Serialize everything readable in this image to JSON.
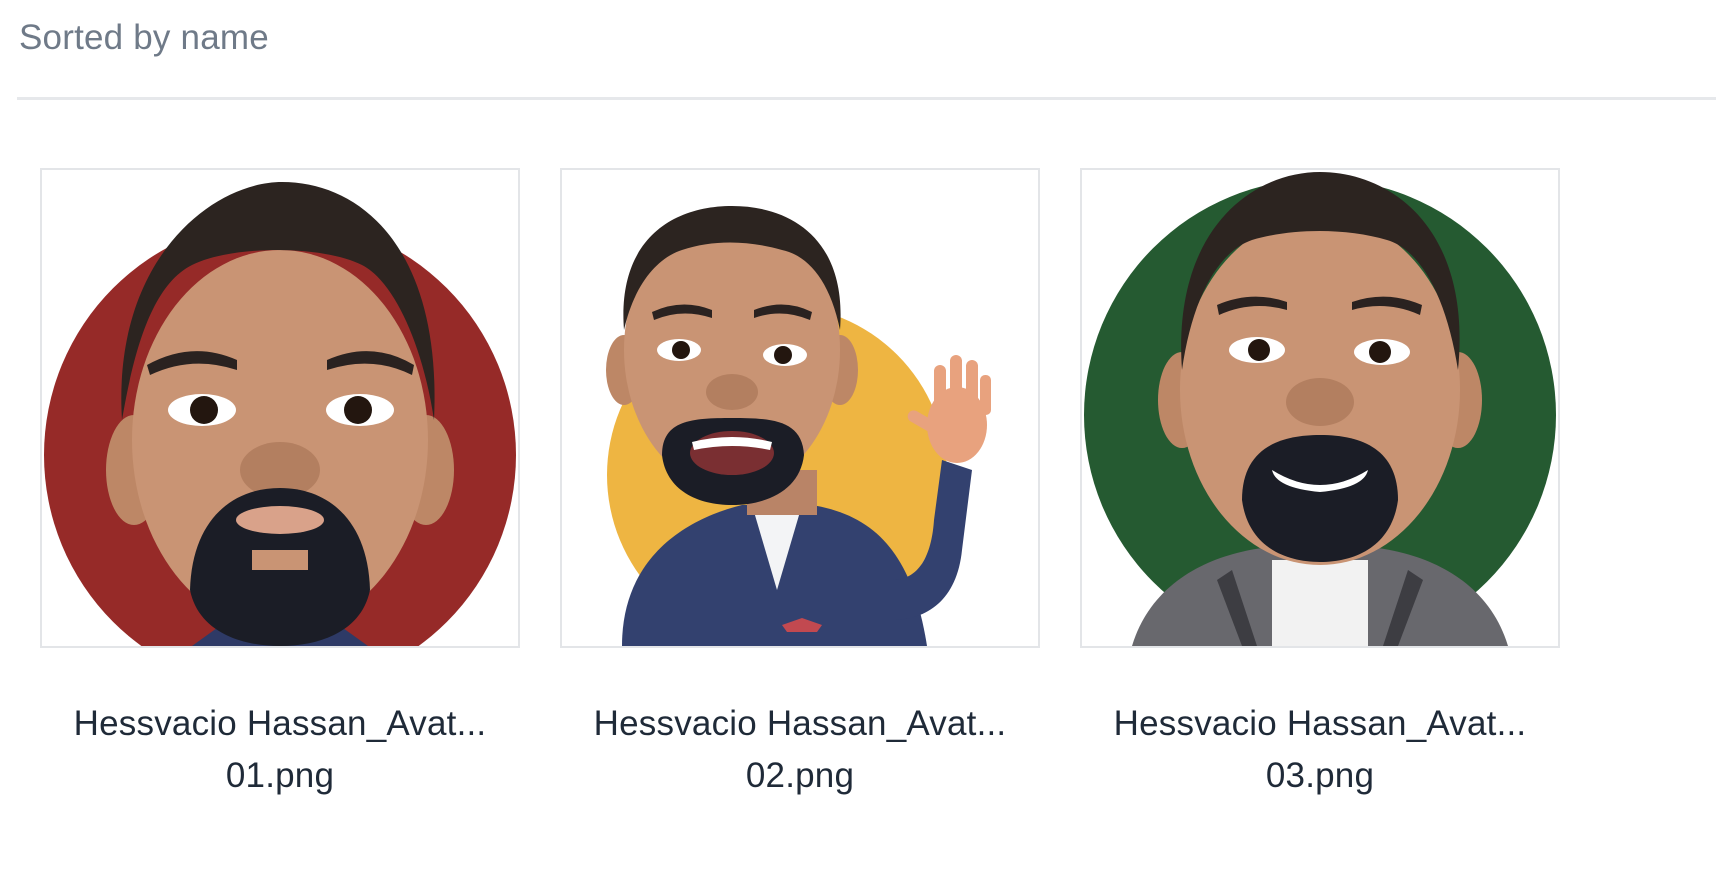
{
  "header": {
    "sort_label": "Sorted by name"
  },
  "files": [
    {
      "name_line1": "Hessvacio Hassan_Avat...",
      "name_line2": "01.png",
      "bg_color": "#962a28",
      "outfit": "collar",
      "mouth": "closed",
      "waving": false
    },
    {
      "name_line1": "Hessvacio Hassan_Avat...",
      "name_line2": "02.png",
      "bg_color": "#eeb542",
      "outfit": "navy-suit",
      "mouth": "open",
      "waving": true
    },
    {
      "name_line1": "Hessvacio Hassan_Avat...",
      "name_line2": "03.png",
      "bg_color": "#255a31",
      "outfit": "grey-jacket",
      "mouth": "smile",
      "waving": false
    }
  ],
  "colors": {
    "skin": "#c99474",
    "hair": "#2c2420",
    "beard": "#1b1d26",
    "text": "#1f2a38",
    "muted": "#6f7a88"
  }
}
